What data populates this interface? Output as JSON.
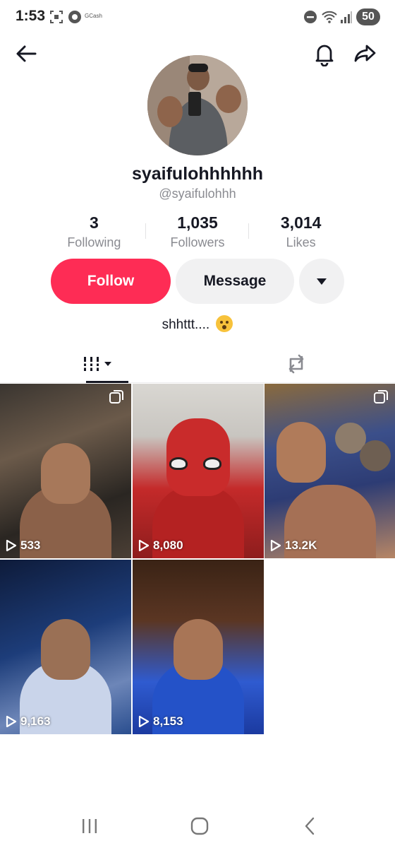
{
  "status_bar": {
    "time": "1:53",
    "gcash_label": "GCash",
    "battery": "50"
  },
  "profile": {
    "display_name": "syaifulohhhhhh",
    "handle": "@syaifulohhh",
    "stats": [
      {
        "value": "3",
        "label": "Following"
      },
      {
        "value": "1,035",
        "label": "Followers"
      },
      {
        "value": "3,014",
        "label": "Likes"
      }
    ],
    "bio": "shhttt...."
  },
  "actions": {
    "follow_label": "Follow",
    "message_label": "Message"
  },
  "colors": {
    "follow_accent": "#fe2c55",
    "secondary_button": "#f1f1f2"
  },
  "tabs": [
    {
      "icon": "videos-grid-icon",
      "active": true
    },
    {
      "icon": "repost-icon",
      "active": false
    }
  ],
  "videos": [
    {
      "views": "533",
      "multi": true
    },
    {
      "views": "8,080",
      "multi": false
    },
    {
      "views": "13.2K",
      "multi": true
    },
    {
      "views": "9,163",
      "multi": false
    },
    {
      "views": "8,153",
      "multi": false
    }
  ]
}
